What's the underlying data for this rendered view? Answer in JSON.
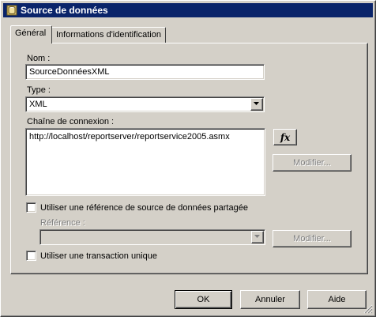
{
  "window": {
    "title": "Source de données"
  },
  "tabs": [
    {
      "label": "Général"
    },
    {
      "label": "Informations d'identification"
    }
  ],
  "form": {
    "name_label": "Nom :",
    "name_value": "SourceDonnéesXML",
    "type_label": "Type :",
    "type_value": "XML",
    "connection_label": "Chaîne de connexion :",
    "connection_value": "http://localhost/reportserver/reportservice2005.asmx",
    "fx_label": "fx",
    "modify_label": "Modifier...",
    "shared_ref_label": "Utiliser une référence de source de données partagée",
    "reference_label": "Référence :",
    "reference_value": "",
    "modify2_label": "Modifier...",
    "single_tx_label": "Utiliser une transaction unique"
  },
  "buttons": {
    "ok": "OK",
    "cancel": "Annuler",
    "help": "Aide"
  },
  "colors": {
    "titlebar": "#0a246a",
    "face": "#d4d0c8",
    "disabled_text": "#808080"
  },
  "icons": {
    "title": "data-source-icon",
    "dropdown": "chevron-down-icon",
    "close": "close-icon"
  }
}
